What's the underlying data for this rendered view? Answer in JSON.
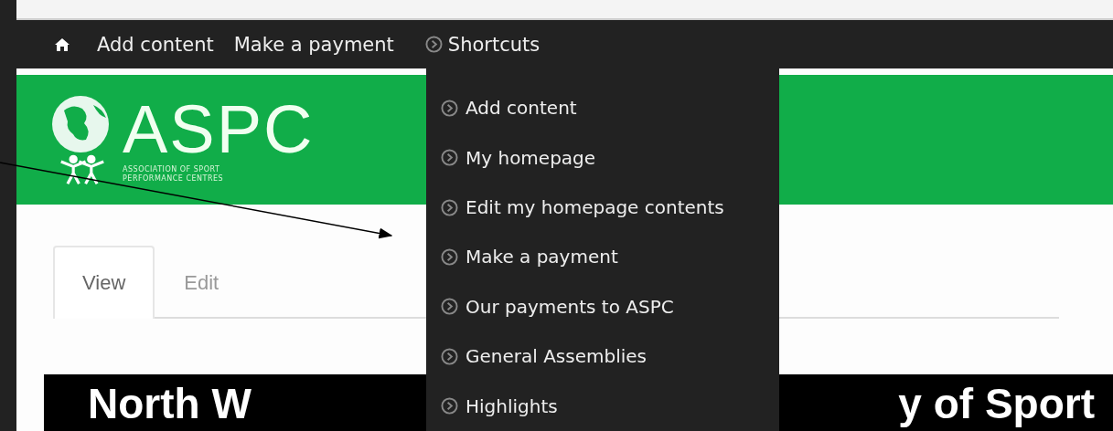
{
  "toolbar": {
    "links": [
      "Add content",
      "Make a payment"
    ],
    "shortcuts": {
      "label": "Shortcuts",
      "items": [
        "Add content",
        "My homepage",
        "Edit my homepage contents",
        "Make a payment",
        "Our payments to ASPC",
        "General Assemblies",
        "Highlights"
      ]
    }
  },
  "logo": {
    "name": "ASPC",
    "subtitle_lines": [
      "ASSOCIATION OF SPORT",
      "PERFORMANCE CENTRES"
    ]
  },
  "tabs": [
    {
      "label": "View",
      "selected": true
    },
    {
      "label": "Edit",
      "selected": false
    }
  ],
  "page_heading": {
    "left_part": "North W",
    "right_part": "y of Sport"
  }
}
